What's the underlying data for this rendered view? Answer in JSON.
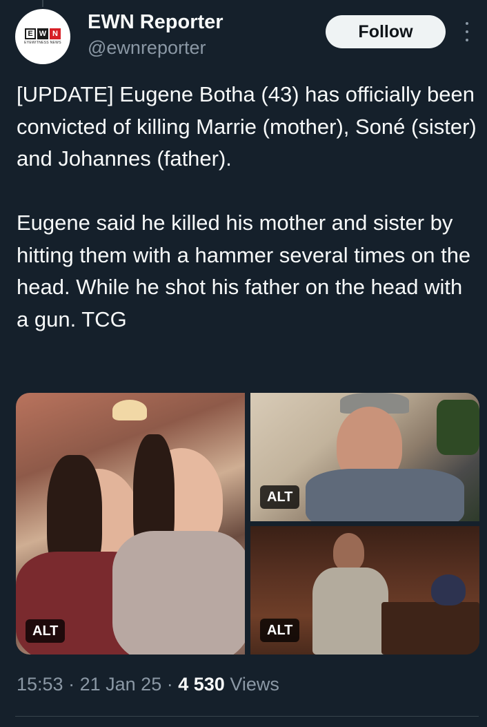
{
  "author": {
    "display_name": "EWN Reporter",
    "handle": "@ewnreporter",
    "logo_letters": [
      "E",
      "W",
      "N"
    ],
    "logo_tagline": "EYEWITNESS NEWS"
  },
  "actions": {
    "follow_label": "Follow",
    "more_icon": "more-vertical-icon"
  },
  "tweet": {
    "text": "[UPDATE] Eugene Botha (43) has officially been convicted of killing Marrie (mother), Soné (sister) and Johannes (father).\n\nEugene said he killed his mother and sister by hitting them with a hammer several times on the head. While he shot his father on the head with a gun. TCG"
  },
  "media": {
    "alt_label": "ALT",
    "photos": [
      {
        "name": "family-photo",
        "alt_label": "ALT"
      },
      {
        "name": "father-photo",
        "alt_label": "ALT"
      },
      {
        "name": "courtroom-photo",
        "alt_label": "ALT"
      }
    ]
  },
  "meta": {
    "time": "15:53",
    "separator": "·",
    "date": "21 Jan 25",
    "views_count": "4 530",
    "views_label": "Views"
  },
  "colors": {
    "background": "#15202b",
    "primary_text": "#f7f9f9",
    "secondary_text": "#8b98a5",
    "follow_bg": "#eff3f4",
    "logo_red": "#d71f26"
  }
}
